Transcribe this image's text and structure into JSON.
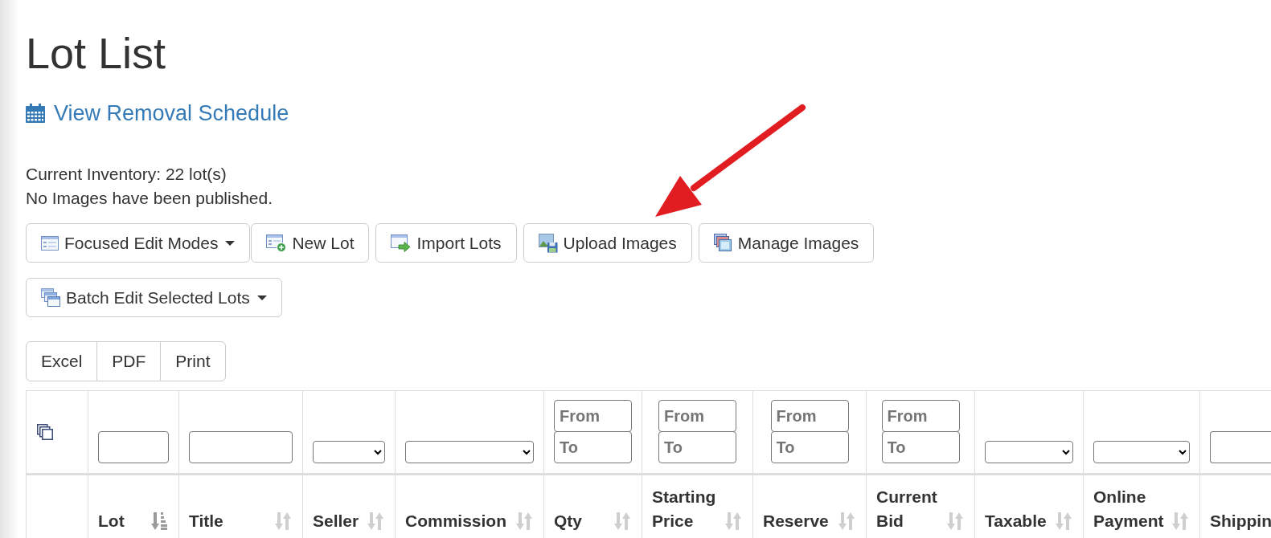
{
  "page": {
    "title": "Lot List"
  },
  "removal_link": {
    "label": "View Removal Schedule"
  },
  "summary": [
    "Current Inventory: 22 lot(s)",
    "No Images have been published."
  ],
  "toolbar_rows": [
    [
      {
        "label": "Focused Edit Modes",
        "kind": "dropdown"
      },
      {
        "label": "New Lot",
        "kind": "button"
      },
      {
        "label": "Import Lots",
        "kind": "button"
      },
      {
        "label": "Upload Images",
        "kind": "button"
      },
      {
        "label": "Manage Images",
        "kind": "button"
      }
    ],
    [
      {
        "label": "Batch Edit Selected Lots",
        "kind": "dropdown"
      }
    ]
  ],
  "export_buttons": [
    "Excel",
    "PDF",
    "Print"
  ],
  "table": {
    "columns": [
      {
        "filter": {
          "kind": "select_all"
        }
      },
      {
        "label": "Lot",
        "sorted": true,
        "filter": {
          "kind": "text"
        }
      },
      {
        "label": "Title",
        "sorted": false,
        "filter": {
          "kind": "text"
        }
      },
      {
        "label": "Seller",
        "sorted": false,
        "filter": {
          "kind": "select"
        }
      },
      {
        "label": "Commission",
        "sorted": false,
        "filter": {
          "kind": "select"
        }
      },
      {
        "label": "Qty",
        "sorted": false,
        "filter": {
          "kind": "range",
          "from": {
            "placeholder": "From"
          },
          "to": {
            "placeholder": "To"
          }
        }
      },
      {
        "label": "Starting Price",
        "sorted": false,
        "filter": {
          "kind": "range",
          "from": {
            "placeholder": "From"
          },
          "to": {
            "placeholder": "To"
          }
        }
      },
      {
        "label": "Reserve",
        "sorted": false,
        "filter": {
          "kind": "range",
          "from": {
            "placeholder": "From"
          },
          "to": {
            "placeholder": "To"
          }
        }
      },
      {
        "label": "Current Bid",
        "sorted": false,
        "filter": {
          "kind": "range",
          "from": {
            "placeholder": "From"
          },
          "to": {
            "placeholder": "To"
          }
        }
      },
      {
        "label": "Taxable",
        "sorted": false,
        "filter": {
          "kind": "select"
        }
      },
      {
        "label": "Online Payment",
        "sorted": false,
        "filter": {
          "kind": "select"
        }
      },
      {
        "label": "Shippin",
        "filter": {
          "kind": "text"
        }
      }
    ]
  }
}
